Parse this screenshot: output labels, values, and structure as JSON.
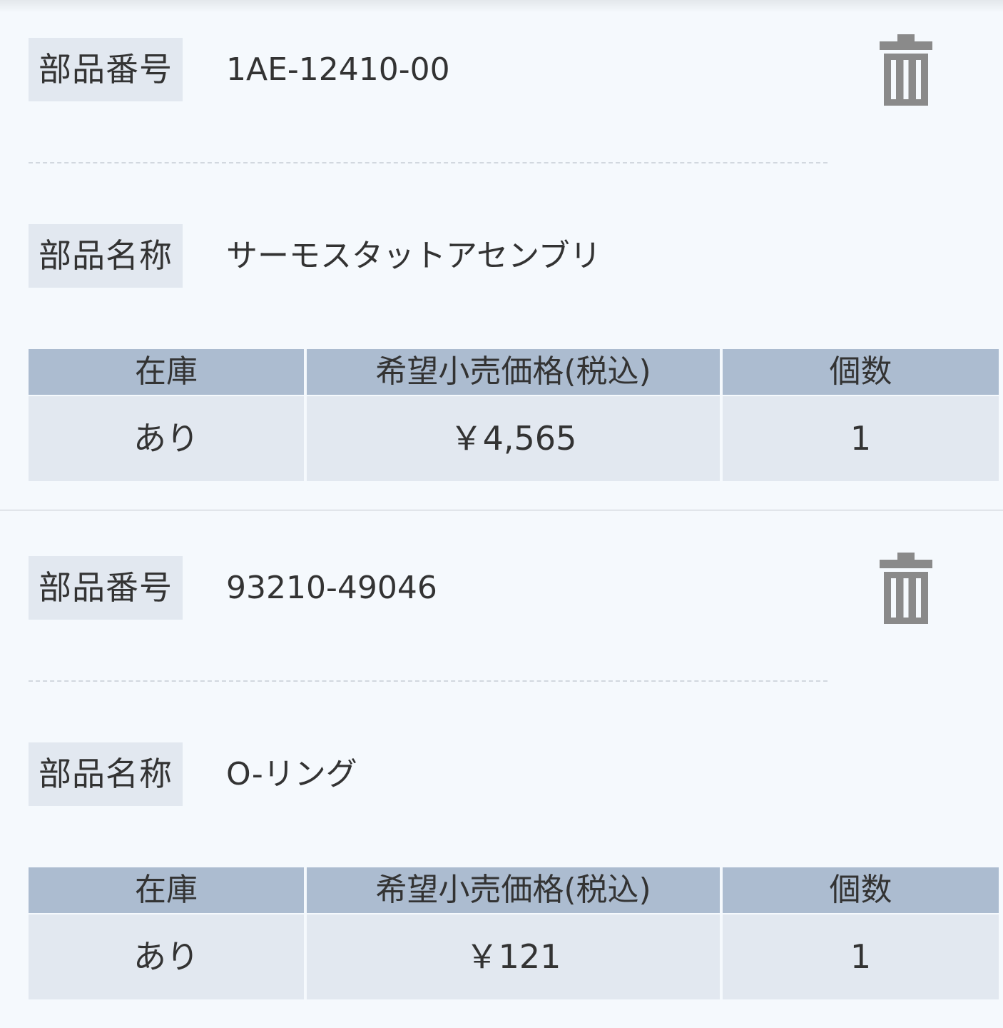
{
  "labels": {
    "part_number": "部品番号",
    "part_name": "部品名称"
  },
  "table_headers": {
    "stock": "在庫",
    "price": "希望小売価格(税込)",
    "quantity": "個数"
  },
  "items": [
    {
      "part_number": "1AE-12410-00",
      "part_name": "サーモスタットアセンブリ",
      "stock": "あり",
      "price": "￥4,565",
      "quantity": "1"
    },
    {
      "part_number": "93210-49046",
      "part_name": "O-リング",
      "stock": "あり",
      "price": "￥121",
      "quantity": "1"
    }
  ],
  "icons": {
    "delete": "trash-icon"
  },
  "colors": {
    "label_background": "#e2e8f0",
    "table_header_background": "#acbcd0",
    "page_background": "#f5f9fd",
    "icon_color": "#8a8a8a"
  }
}
